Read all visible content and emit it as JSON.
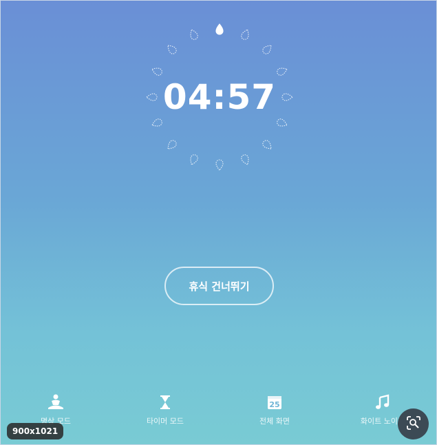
{
  "timer": {
    "remaining": "04:57",
    "total_drops": 16,
    "active_drops": 1
  },
  "skip_button": {
    "label": "휴식 건너뛰기"
  },
  "bottom_nav": [
    {
      "icon": "meditation-icon",
      "label": "명상 모드"
    },
    {
      "icon": "hourglass-icon",
      "label": "타이머 모드"
    },
    {
      "icon": "calendar-icon",
      "label": "전체 화면",
      "icon_text": "25"
    },
    {
      "icon": "music-note-icon",
      "label": "화이트 노이즈"
    }
  ],
  "overlay": {
    "size_badge": "900x1021",
    "lens_icon": "visual-search-icon"
  },
  "colors": {
    "gradient_top": "#6a8fd6",
    "gradient_bottom": "#79cbd4",
    "foreground": "#ffffff"
  }
}
